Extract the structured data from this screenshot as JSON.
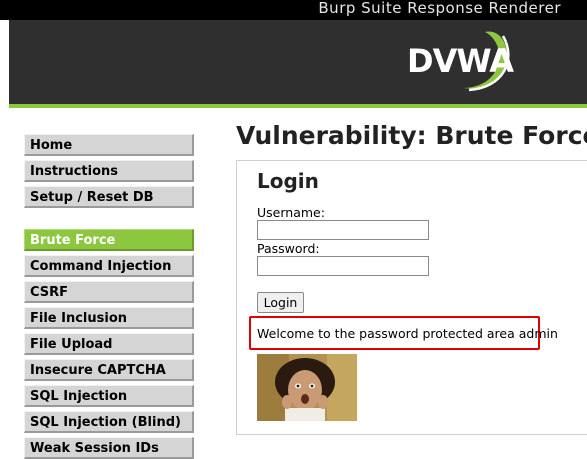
{
  "window": {
    "title": "Burp Suite Response Renderer"
  },
  "logo": {
    "text": "DVWA",
    "accent": "#8dc63f"
  },
  "colors": {
    "header_bg": "#2f2f2f",
    "accent": "#8dc63f",
    "menu_bg": "#d5d5d5",
    "alert_border": "#e00000"
  },
  "sidebar": {
    "items": [
      {
        "label": "Home"
      },
      {
        "label": "Instructions"
      },
      {
        "label": "Setup / Reset DB"
      },
      {
        "label": "Brute Force",
        "active": true
      },
      {
        "label": "Command Injection"
      },
      {
        "label": "CSRF"
      },
      {
        "label": "File Inclusion"
      },
      {
        "label": "File Upload"
      },
      {
        "label": "Insecure CAPTCHA"
      },
      {
        "label": "SQL Injection"
      },
      {
        "label": "SQL Injection (Blind)"
      },
      {
        "label": "Weak Session IDs"
      }
    ]
  },
  "main": {
    "heading": "Vulnerability: Brute Force",
    "login": {
      "title": "Login",
      "username_label": "Username:",
      "username_value": "",
      "password_label": "Password:",
      "password_value": "",
      "button_label": "Login"
    },
    "result_message": "Welcome to the password protected area admin",
    "avatar": {
      "icon": "user-photo"
    }
  }
}
